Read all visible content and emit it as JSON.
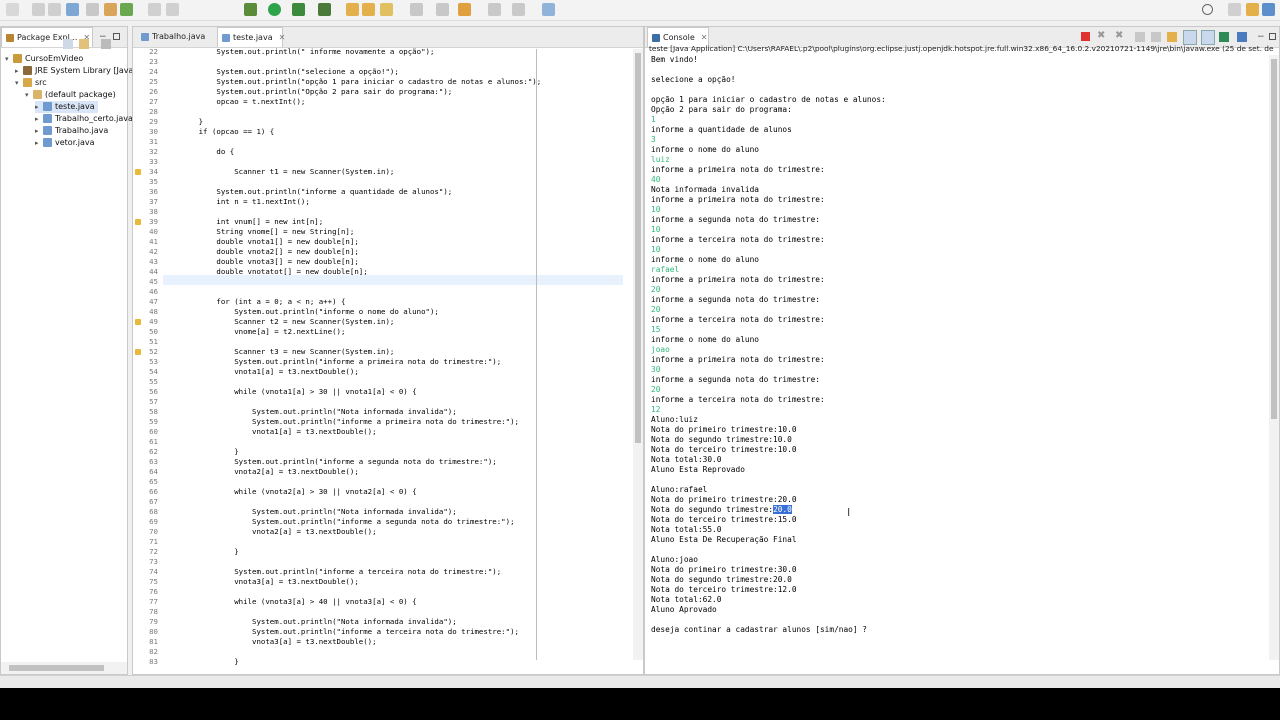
{
  "colors": {
    "accent": "#3a6fd8",
    "input_text": "#2eb87a",
    "keyword": "#7f0055",
    "string": "#2a00ff",
    "field": "#0000c0"
  },
  "package_explorer": {
    "tab_label": "Package Expl...",
    "items": [
      {
        "label": "CursoEmVideo",
        "icon": "project-icon",
        "depth": 0,
        "twisty": "▾"
      },
      {
        "label": "JRE System Library [JavaSE",
        "icon": "library-icon",
        "depth": 1,
        "twisty": "▸"
      },
      {
        "label": "src",
        "icon": "source-folder-icon",
        "depth": 1,
        "twisty": "▾"
      },
      {
        "label": "(default package)",
        "icon": "package-icon",
        "depth": 2,
        "twisty": "▾"
      },
      {
        "label": "teste.java",
        "icon": "java-file-icon",
        "depth": 3,
        "twisty": "▸",
        "selected": true
      },
      {
        "label": "Trabalho_certo.java",
        "icon": "java-file-icon",
        "depth": 3,
        "twisty": "▸"
      },
      {
        "label": "Trabalho.java",
        "icon": "java-file-icon",
        "depth": 3,
        "twisty": "▸"
      },
      {
        "label": "vetor.java",
        "icon": "java-file-icon",
        "depth": 3,
        "twisty": "▸"
      }
    ]
  },
  "editor": {
    "tabs": [
      {
        "label": "Trabalho.java"
      },
      {
        "label": "teste.java"
      }
    ],
    "lines": [
      {
        "n": "22",
        "t": "            System.out.println(\" informe novamente a opção\");",
        "mark": false
      },
      {
        "n": "23",
        "t": "",
        "mark": false
      },
      {
        "n": "24",
        "t": "            System.out.println(\"selecione a opção!\");",
        "mark": false
      },
      {
        "n": "25",
        "t": "            System.out.println(\"opção 1 para iniciar o cadastro de notas e alunos:\");",
        "mark": false
      },
      {
        "n": "26",
        "t": "            System.out.println(\"Opção 2 para sair do programa:\");",
        "mark": false
      },
      {
        "n": "27",
        "t": "            opcao = t.nextInt();",
        "mark": false
      },
      {
        "n": "28",
        "t": "",
        "mark": false
      },
      {
        "n": "29",
        "t": "        }",
        "mark": false
      },
      {
        "n": "30",
        "t": "        if (opcao == 1) {",
        "mark": false
      },
      {
        "n": "31",
        "t": "",
        "mark": false
      },
      {
        "n": "32",
        "t": "            do {",
        "mark": false
      },
      {
        "n": "33",
        "t": "",
        "mark": false
      },
      {
        "n": "34",
        "t": "                Scanner t1 = new Scanner(System.in);",
        "mark": true
      },
      {
        "n": "35",
        "t": "",
        "mark": false
      },
      {
        "n": "36",
        "t": "            System.out.println(\"informe a quantidade de alunos\");",
        "mark": false
      },
      {
        "n": "37",
        "t": "            int n = t1.nextInt();",
        "mark": false
      },
      {
        "n": "38",
        "t": "",
        "mark": false
      },
      {
        "n": "39",
        "t": "            int vnum[] = new int[n];",
        "mark": true
      },
      {
        "n": "40",
        "t": "            String vnome[] = new String[n];",
        "mark": false
      },
      {
        "n": "41",
        "t": "            double vnota1[] = new double[n];",
        "mark": false
      },
      {
        "n": "42",
        "t": "            double vnota2[] = new double[n];",
        "mark": false
      },
      {
        "n": "43",
        "t": "            double vnota3[] = new double[n];",
        "mark": false
      },
      {
        "n": "44",
        "t": "            double vnotatot[] = new double[n];",
        "mark": false
      },
      {
        "n": "45",
        "t": "",
        "mark": false
      },
      {
        "n": "46",
        "t": "",
        "mark": false
      },
      {
        "n": "47",
        "t": "            for (int a = 0; a < n; a++) {",
        "mark": false
      },
      {
        "n": "48",
        "t": "                System.out.println(\"informe o nome do aluno\");",
        "mark": false
      },
      {
        "n": "49",
        "t": "                Scanner t2 = new Scanner(System.in);",
        "mark": true
      },
      {
        "n": "50",
        "t": "                vnome[a] = t2.nextLine();",
        "mark": false
      },
      {
        "n": "51",
        "t": "",
        "mark": false
      },
      {
        "n": "52",
        "t": "                Scanner t3 = new Scanner(System.in);",
        "mark": true
      },
      {
        "n": "53",
        "t": "                System.out.println(\"informe a primeira nota do trimestre:\");",
        "mark": false
      },
      {
        "n": "54",
        "t": "                vnota1[a] = t3.nextDouble();",
        "mark": false
      },
      {
        "n": "55",
        "t": "",
        "mark": false
      },
      {
        "n": "56",
        "t": "                while (vnota1[a] > 30 || vnota1[a] < 0) {",
        "mark": false
      },
      {
        "n": "57",
        "t": "",
        "mark": false
      },
      {
        "n": "58",
        "t": "                    System.out.println(\"Nota informada invalida\");",
        "mark": false
      },
      {
        "n": "59",
        "t": "                    System.out.println(\"informe a primeira nota do trimestre:\");",
        "mark": false
      },
      {
        "n": "60",
        "t": "                    vnota1[a] = t3.nextDouble();",
        "mark": false
      },
      {
        "n": "61",
        "t": "",
        "mark": false
      },
      {
        "n": "62",
        "t": "                }",
        "mark": false
      },
      {
        "n": "63",
        "t": "                System.out.println(\"informe a segunda nota do trimestre:\");",
        "mark": false
      },
      {
        "n": "64",
        "t": "                vnota2[a] = t3.nextDouble();",
        "mark": false
      },
      {
        "n": "65",
        "t": "",
        "mark": false
      },
      {
        "n": "66",
        "t": "                while (vnota2[a] > 30 || vnota2[a] < 0) {",
        "mark": false
      },
      {
        "n": "67",
        "t": "",
        "mark": false
      },
      {
        "n": "68",
        "t": "                    System.out.println(\"Nota informada invalida\");",
        "mark": false
      },
      {
        "n": "69",
        "t": "                    System.out.println(\"informe a segunda nota do trimestre:\");",
        "mark": false
      },
      {
        "n": "70",
        "t": "                    vnota2[a] = t3.nextDouble();",
        "mark": false
      },
      {
        "n": "71",
        "t": "",
        "mark": false
      },
      {
        "n": "72",
        "t": "                }",
        "mark": false
      },
      {
        "n": "73",
        "t": "",
        "mark": false
      },
      {
        "n": "74",
        "t": "                System.out.println(\"informe a terceira nota do trimestre:\");",
        "mark": false
      },
      {
        "n": "75",
        "t": "                vnota3[a] = t3.nextDouble();",
        "mark": false
      },
      {
        "n": "76",
        "t": "",
        "mark": false
      },
      {
        "n": "77",
        "t": "                while (vnota3[a] > 40 || vnota3[a] < 0) {",
        "mark": false
      },
      {
        "n": "78",
        "t": "",
        "mark": false
      },
      {
        "n": "79",
        "t": "                    System.out.println(\"Nota informada invalida\");",
        "mark": false
      },
      {
        "n": "80",
        "t": "                    System.out.println(\"informe a terceira nota do trimestre:\");",
        "mark": false
      },
      {
        "n": "81",
        "t": "                    vnota3[a] = t3.nextDouble();",
        "mark": false
      },
      {
        "n": "82",
        "t": "",
        "mark": false
      },
      {
        "n": "83",
        "t": "                }",
        "mark": false
      }
    ]
  },
  "console": {
    "tab_label": "Console",
    "header": "teste [Java Application] C:\\Users\\RAFAEL\\.p2\\pool\\plugins\\org.eclipse.justj.openjdk.hotspot.jre.full.win32.x86_64_16.0.2.v20210721-1149\\jre\\bin\\javaw.exe  (25 de set. de 2021 12:20:",
    "lines": [
      {
        "t": "Bem vindo!",
        "k": "out"
      },
      {
        "t": "",
        "k": "out"
      },
      {
        "t": "selecione a opção!",
        "k": "out"
      },
      {
        "t": "",
        "k": "out"
      },
      {
        "t": "opção 1 para iniciar o cadastro de notas e alunos:",
        "k": "out"
      },
      {
        "t": "Opção 2 para sair do programa:",
        "k": "out"
      },
      {
        "t": "1",
        "k": "inp"
      },
      {
        "t": "informe a quantidade de alunos",
        "k": "out"
      },
      {
        "t": "3",
        "k": "inp"
      },
      {
        "t": "informe o nome do aluno",
        "k": "out"
      },
      {
        "t": "luiz",
        "k": "inp"
      },
      {
        "t": "informe a primeira nota do trimestre:",
        "k": "out"
      },
      {
        "t": "40",
        "k": "inp"
      },
      {
        "t": "Nota informada invalida",
        "k": "out"
      },
      {
        "t": "informe a primeira nota do trimestre:",
        "k": "out"
      },
      {
        "t": "10",
        "k": "inp"
      },
      {
        "t": "informe a segunda nota do trimestre:",
        "k": "out"
      },
      {
        "t": "10",
        "k": "inp"
      },
      {
        "t": "informe a terceira nota do trimestre:",
        "k": "out"
      },
      {
        "t": "10",
        "k": "inp"
      },
      {
        "t": "informe o nome do aluno",
        "k": "out"
      },
      {
        "t": "rafael",
        "k": "inp"
      },
      {
        "t": "informe a primeira nota do trimestre:",
        "k": "out"
      },
      {
        "t": "20",
        "k": "inp"
      },
      {
        "t": "informe a segunda nota do trimestre:",
        "k": "out"
      },
      {
        "t": "20",
        "k": "inp"
      },
      {
        "t": "informe a terceira nota do trimestre:",
        "k": "out"
      },
      {
        "t": "15",
        "k": "inp"
      },
      {
        "t": "informe o nome do aluno",
        "k": "out"
      },
      {
        "t": "joao",
        "k": "inp"
      },
      {
        "t": "informe a primeira nota do trimestre:",
        "k": "out"
      },
      {
        "t": "30",
        "k": "inp"
      },
      {
        "t": "informe a segunda nota do trimestre:",
        "k": "out"
      },
      {
        "t": "20",
        "k": "inp"
      },
      {
        "t": "informe a terceira nota do trimestre:",
        "k": "out"
      },
      {
        "t": "12",
        "k": "inp"
      },
      {
        "t": "Aluno:luiz",
        "k": "out"
      },
      {
        "t": "Nota do primeiro trimestre:10.0",
        "k": "out"
      },
      {
        "t": "Nota do segundo trimestre:10.0",
        "k": "out"
      },
      {
        "t": "Nota do terceiro trimestre:10.0",
        "k": "out"
      },
      {
        "t": "Nota total:30.0",
        "k": "out"
      },
      {
        "t": "Aluno Esta Reprovado",
        "k": "out"
      },
      {
        "t": "",
        "k": "out"
      },
      {
        "t": "Aluno:rafael",
        "k": "out"
      },
      {
        "t": "Nota do primeiro trimestre:20.0",
        "k": "out"
      },
      {
        "t": "Nota do segundo trimestre:",
        "k": "out",
        "sel": "20.0"
      },
      {
        "t": "Nota do terceiro trimestre:15.0",
        "k": "out"
      },
      {
        "t": "Nota total:55.0",
        "k": "out"
      },
      {
        "t": "Aluno Esta De Recuperação Final",
        "k": "out"
      },
      {
        "t": "",
        "k": "out"
      },
      {
        "t": "Aluno:joao",
        "k": "out"
      },
      {
        "t": "Nota do primeiro trimestre:30.0",
        "k": "out"
      },
      {
        "t": "Nota do segundo trimestre:20.0",
        "k": "out"
      },
      {
        "t": "Nota do terceiro trimestre:12.0",
        "k": "out"
      },
      {
        "t": "Nota total:62.0",
        "k": "out"
      },
      {
        "t": "Aluno Aprovado",
        "k": "out"
      },
      {
        "t": "",
        "k": "out"
      },
      {
        "t": "deseja continar a cadastrar alunos [sim/nao] ?",
        "k": "out"
      }
    ]
  }
}
